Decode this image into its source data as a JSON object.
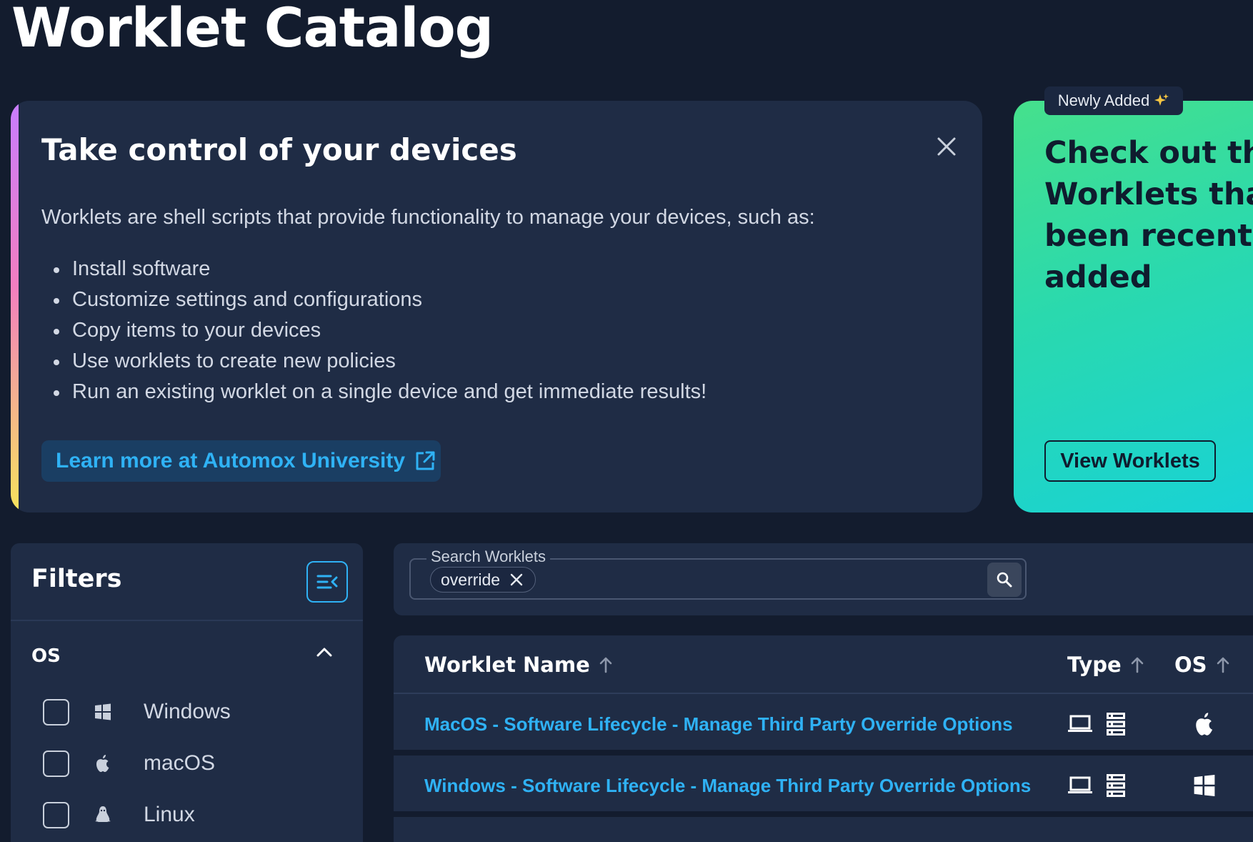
{
  "page_title": "Worklet Catalog",
  "intro": {
    "heading": "Take control of your devices",
    "description": "Worklets are shell scripts that provide functionality to manage your devices, such as:",
    "items": [
      "Install software",
      "Customize settings and configurations",
      "Copy items to your devices",
      "Use worklets to create new policies",
      "Run an existing worklet on a single device and get immediate results!"
    ],
    "learn_more_label": "Learn more at Automox University"
  },
  "promo": {
    "badge": "Newly Added",
    "badge_icon": "sparkles-icon",
    "heading_lines": [
      "Check out th",
      "Worklets tha",
      "been recentl",
      "added"
    ],
    "button_label": "View Worklets"
  },
  "filters": {
    "title": "Filters",
    "os_section_label": "OS",
    "os_options": [
      {
        "label": "Windows",
        "icon": "windows-icon",
        "checked": false
      },
      {
        "label": "macOS",
        "icon": "apple-icon",
        "checked": false
      },
      {
        "label": "Linux",
        "icon": "linux-icon",
        "checked": false
      }
    ]
  },
  "search": {
    "legend": "Search Worklets",
    "chip": "override"
  },
  "table": {
    "columns": [
      "Worklet Name",
      "Type",
      "OS"
    ],
    "rows": [
      {
        "name": "MacOS - Software Lifecycle - Manage Third Party Override Options",
        "types": [
          "laptop-icon",
          "server-icon"
        ],
        "os": "apple-icon"
      },
      {
        "name": "Windows - Software Lifecycle - Manage Third Party Override Options",
        "types": [
          "laptop-icon",
          "server-icon"
        ],
        "os": "windows-icon"
      }
    ]
  },
  "colors": {
    "background": "#131c2e",
    "card": "#1f2c45",
    "accent_blue": "#2fb2f5",
    "promo_green": "#46e08c",
    "promo_cyan": "#18d2d6"
  }
}
